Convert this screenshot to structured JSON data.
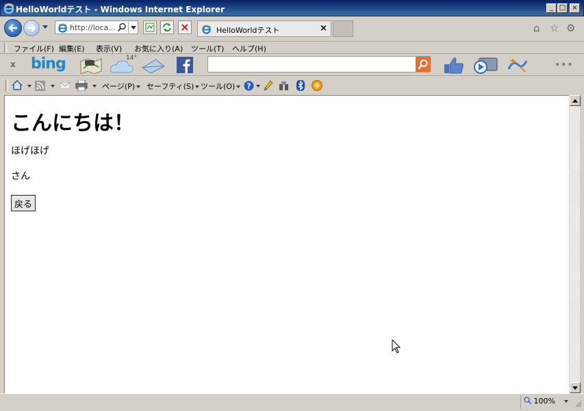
{
  "window": {
    "title": "HelloWorldテスト - Windows Internet Explorer",
    "minimize": "_",
    "maximize": "□",
    "close": "×"
  },
  "nav": {
    "address": "http://loca...",
    "tab_label": "HelloWorldテスト",
    "tab_close": "×"
  },
  "menu": {
    "items": [
      "ファイル(F)",
      "編集(E)",
      "表示(V)",
      "お気に入り(A)",
      "ツール(T)",
      "ヘルプ(H)"
    ]
  },
  "bing_toolbar": {
    "close": "x",
    "brand": "bing",
    "weather_temp": "14°",
    "search_value": "",
    "more": "•••"
  },
  "command_bar": {
    "page": "ページ(P)",
    "safety": "セーフティ(S)",
    "tools": "ツール(O)"
  },
  "content": {
    "heading": "こんにちは！",
    "line1": "ほげほげ",
    "line2": "さん",
    "back_button": "戻る"
  },
  "status": {
    "zoom": "100%"
  },
  "colors": {
    "title_bar": "#0a246a",
    "bing_blue": "#1e88cc",
    "search_orange": "#e8702a",
    "chrome": "#d4d0c8"
  }
}
